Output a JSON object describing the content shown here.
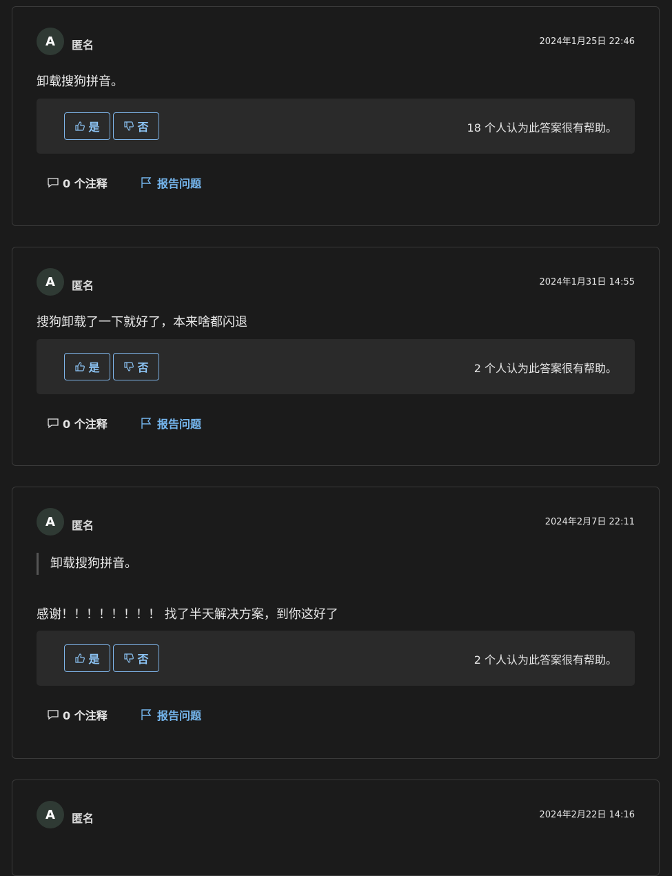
{
  "labels": {
    "yes": "是",
    "no": "否",
    "report": "报告问题"
  },
  "colors": {
    "background": "#1b1b1b",
    "card_border": "#3a3a3a",
    "vote_panel": "#2a2a2a",
    "accent": "#75b6ee",
    "avatar": "#2f3a34"
  },
  "icons": {
    "like": "thumbs-up-icon",
    "dislike": "thumbs-down-icon",
    "comment": "speech-bubble-icon",
    "report": "flag-icon"
  },
  "answers": [
    {
      "avatar": "A",
      "author": "匿名",
      "date": "2024年1月25日 22:46",
      "body": "卸载搜狗拼音。",
      "helpful": "18 个人认为此答案很有帮助。",
      "comments": "0 个注释"
    },
    {
      "avatar": "A",
      "author": "匿名",
      "date": "2024年1月31日 14:55",
      "body": "搜狗卸载了一下就好了，本来啥都闪退",
      "helpful": "2 个人认为此答案很有帮助。",
      "comments": "0 个注释"
    },
    {
      "avatar": "A",
      "author": "匿名",
      "date": "2024年2月7日 22:11",
      "quote": "卸载搜狗拼音。",
      "body": "感谢！！！！！！！！ 找了半天解决方案，到你这好了",
      "helpful": "2 个人认为此答案很有帮助。",
      "comments": "0 个注释"
    },
    {
      "avatar": "A",
      "author": "匿名",
      "date": "2024年2月22日 14:16"
    }
  ]
}
